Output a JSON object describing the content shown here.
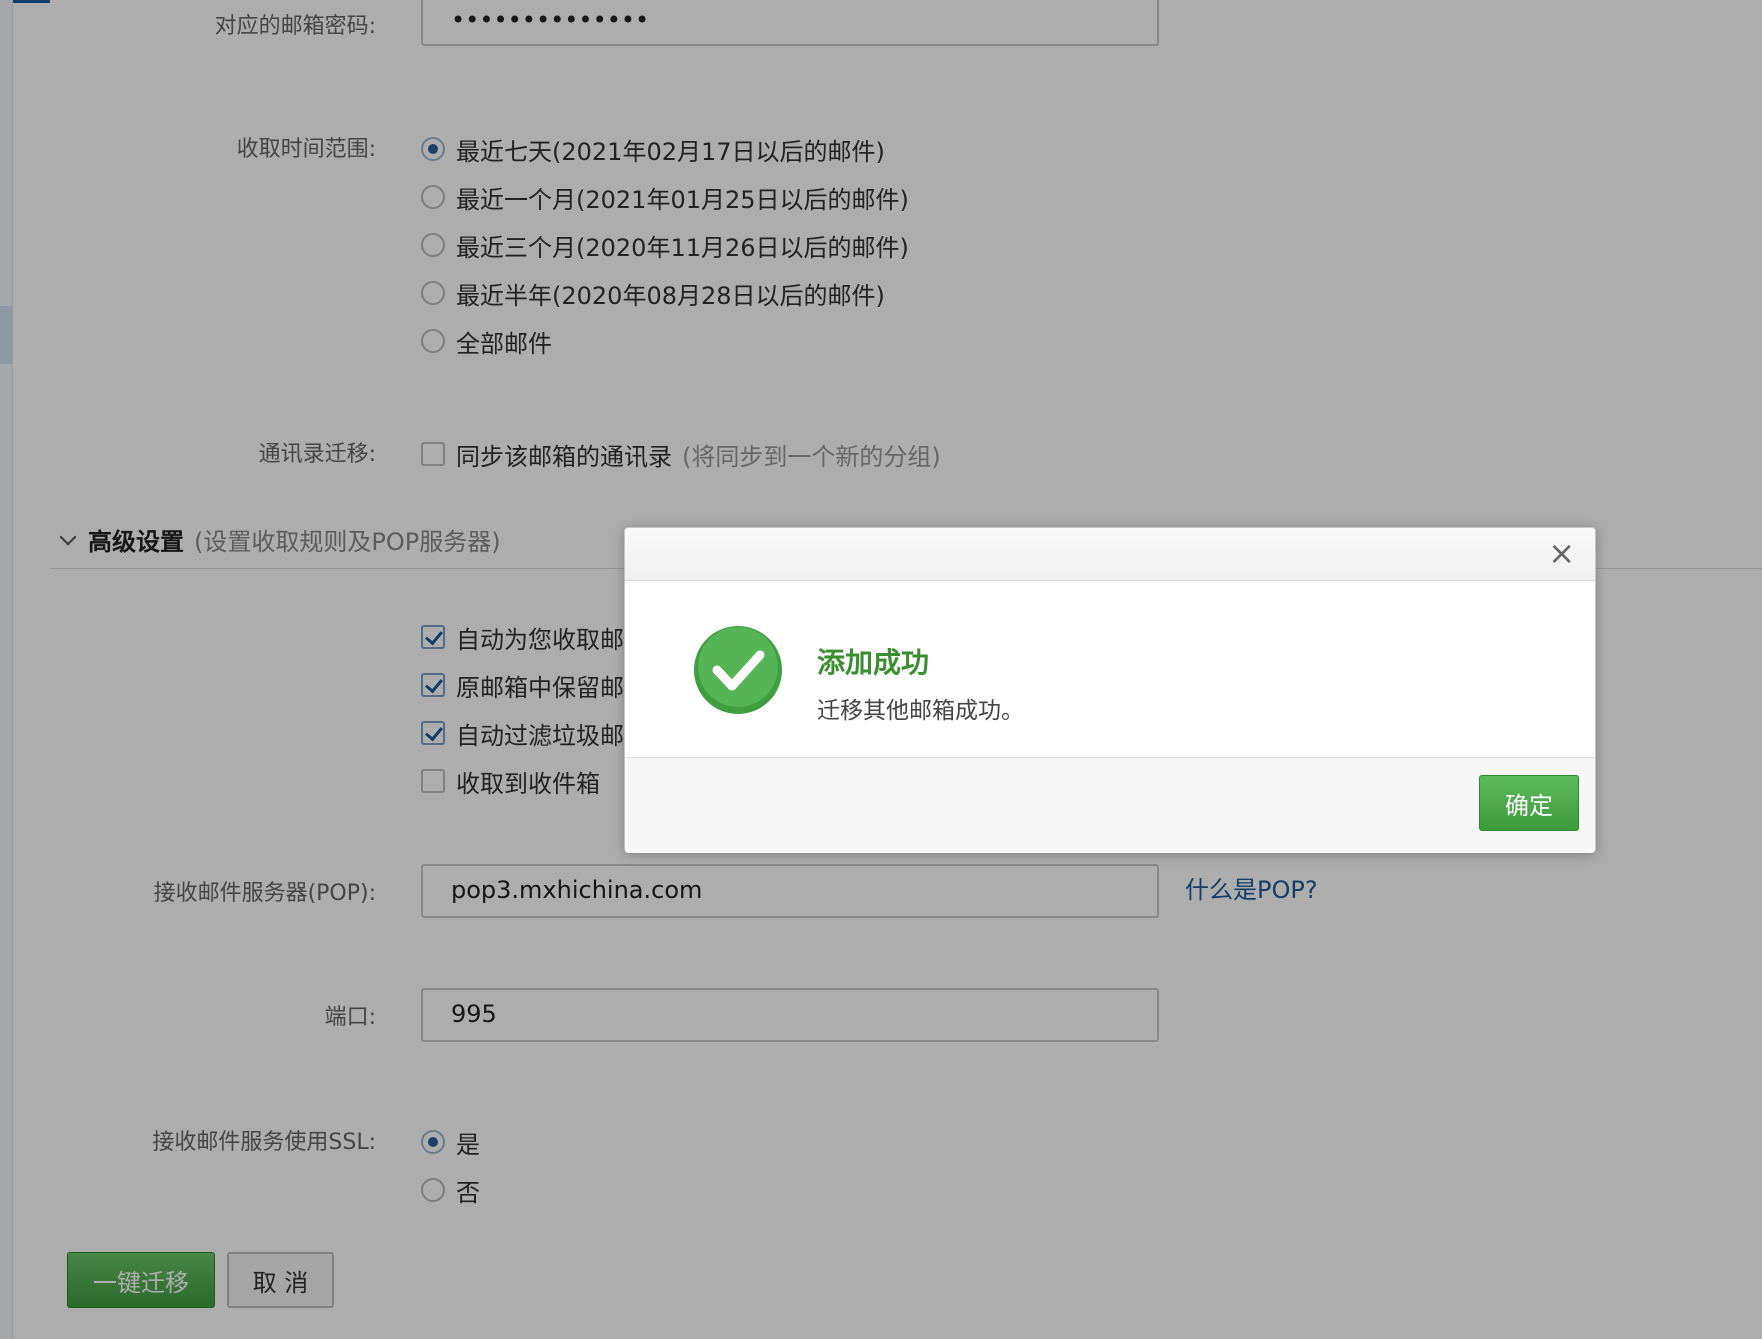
{
  "form": {
    "password_label": "对应的邮箱密码:",
    "password_value": "••••••••••••••",
    "time_range_label": "收取时间范围:",
    "time_range_options": [
      {
        "label": "最近七天(2021年02月17日以后的邮件)",
        "selected": true
      },
      {
        "label": "最近一个月(2021年01月25日以后的邮件)",
        "selected": false
      },
      {
        "label": "最近三个月(2020年11月26日以后的邮件)",
        "selected": false
      },
      {
        "label": "最近半年(2020年08月28日以后的邮件)",
        "selected": false
      },
      {
        "label": "全部邮件",
        "selected": false
      }
    ],
    "contacts_label": "通讯录迁移:",
    "contacts_option": "同步该邮箱的通讯录",
    "contacts_note": "(将同步到一个新的分组)"
  },
  "advanced": {
    "title": "高级设置",
    "subtitle": "(设置收取规则及POP服务器)",
    "checks": [
      {
        "label": "自动为您收取邮",
        "checked": true
      },
      {
        "label": "原邮箱中保留邮",
        "checked": true
      },
      {
        "label": "自动过滤垃圾邮",
        "checked": true
      },
      {
        "label": "收取到收件箱",
        "checked": false
      }
    ],
    "pop_label": "接收邮件服务器(POP):",
    "pop_value": "pop3.mxhichina.com",
    "pop_help": "什么是POP?",
    "port_label": "端口:",
    "port_value": "995",
    "ssl_label": "接收邮件服务使用SSL:",
    "ssl_options": [
      {
        "label": "是",
        "selected": true
      },
      {
        "label": "否",
        "selected": false
      }
    ]
  },
  "actions": {
    "migrate": "一键迁移",
    "cancel": "取 消"
  },
  "modal": {
    "close": "×",
    "title": "添加成功",
    "message": "迁移其他邮箱成功。",
    "ok": "确定",
    "icon": "success-check-icon",
    "accent": "#3a8e2f"
  }
}
